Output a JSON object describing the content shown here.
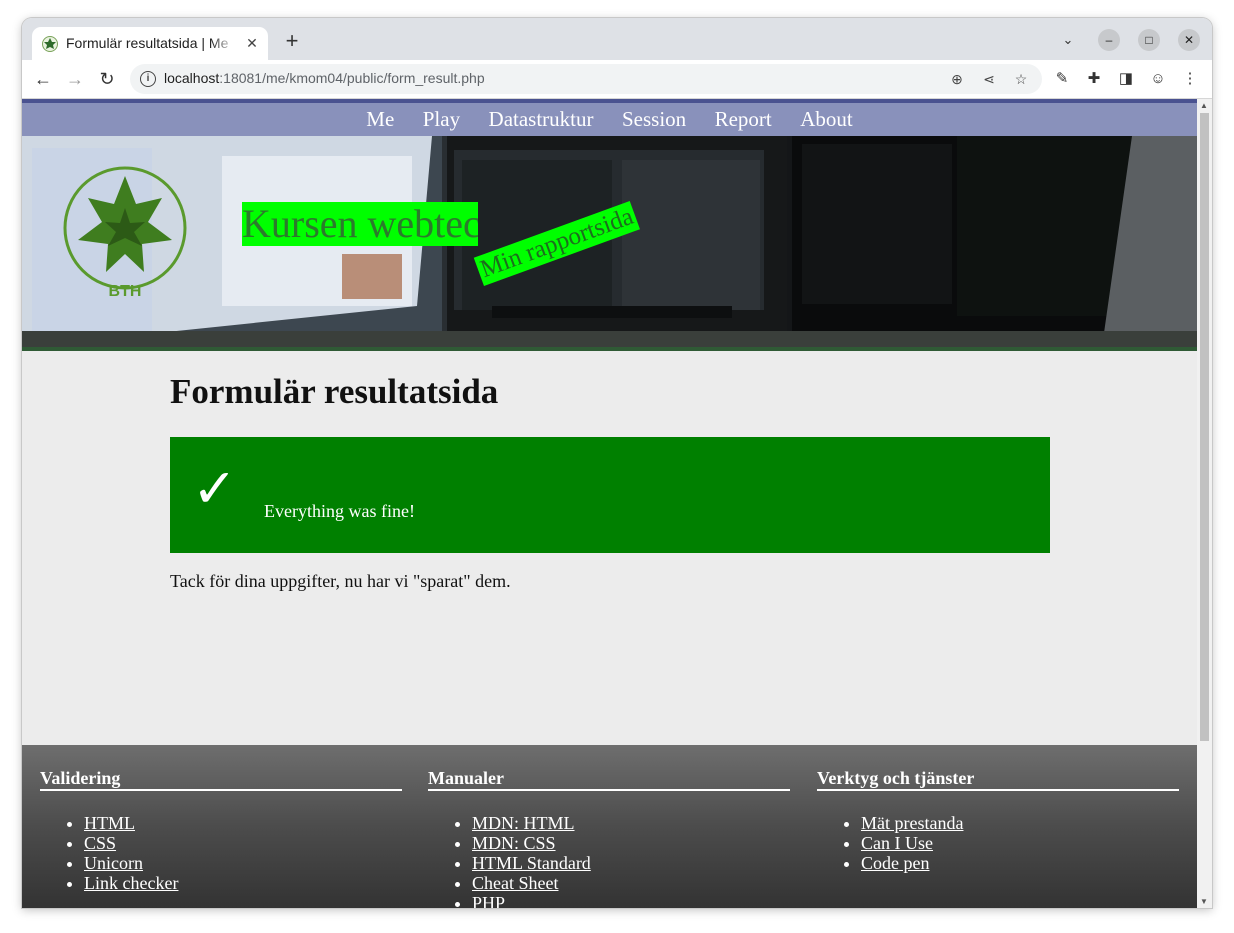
{
  "browser": {
    "tab_title": "Formulär resultatsida | Me",
    "new_tab_symbol": "+",
    "url_host": "localhost",
    "url_rest": ":18081/me/kmom04/public/form_result.php"
  },
  "nav": {
    "items": [
      "Me",
      "Play",
      "Datastruktur",
      "Session",
      "Report",
      "About"
    ]
  },
  "header": {
    "site_title": "Kursen webtec",
    "slogan": "Min rapportsida",
    "logo_text": "BLEKINGE TEKNISKA HÖGSKOLA BTH"
  },
  "main": {
    "title": "Formulär resultatsida",
    "flash_icon": "✓",
    "flash_message": "Everything was fine!",
    "text": "Tack för dina uppgifter, nu har vi \"sparat\" dem."
  },
  "footer": {
    "columns": [
      {
        "heading": "Validering",
        "links": [
          "HTML",
          "CSS",
          "Unicorn",
          "Link checker"
        ]
      },
      {
        "heading": "Manualer",
        "links": [
          "MDN: HTML",
          "MDN: CSS",
          "HTML Standard",
          "Cheat Sheet",
          "PHP"
        ]
      },
      {
        "heading": "Verktyg och tjänster",
        "links": [
          "Mät prestanda",
          "Can I Use",
          "Code pen"
        ]
      }
    ]
  },
  "colors": {
    "nav_bg": "#8991bb",
    "flash_bg": "#008000",
    "title_bg": "#00ff00"
  }
}
